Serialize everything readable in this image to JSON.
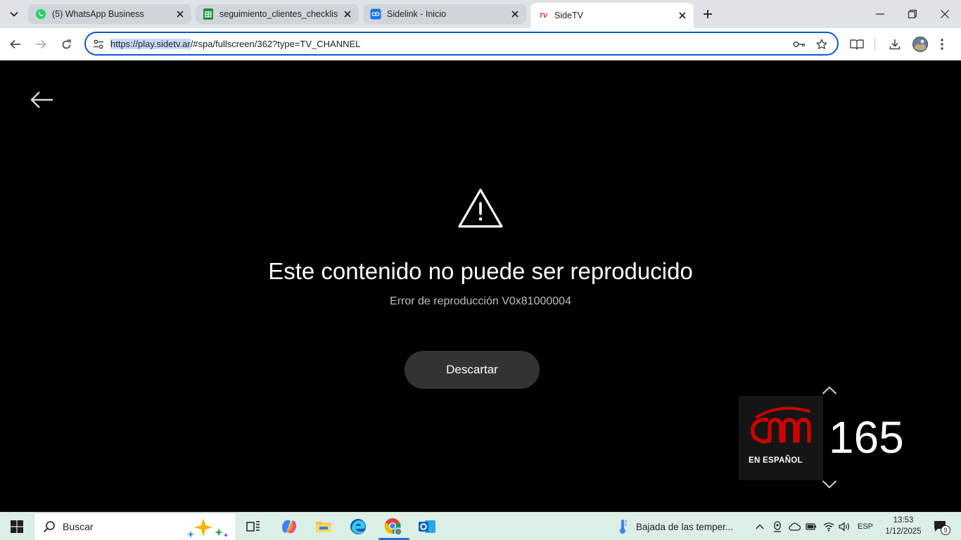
{
  "browser": {
    "tabs": [
      {
        "title": "(5) WhatsApp Business",
        "active": false,
        "favicon": "whatsapp-icon"
      },
      {
        "title": "seguimiento_clientes_checklist",
        "active": false,
        "favicon": "sheets-icon"
      },
      {
        "title": "Sidelink - Inicio",
        "active": false,
        "favicon": "sidelink-icon"
      },
      {
        "title": "SideTV",
        "active": true,
        "favicon": "sidetv-icon"
      }
    ],
    "sidetv_favicon_text": "TV",
    "url_highlight": "https://play.sidetv.ar",
    "url_rest": "/#spa/fullscreen/362?type=TV_CHANNEL",
    "accent": "#0b57d0"
  },
  "player": {
    "error_title": "Este contenido no puede ser reproducido",
    "error_code": "Error de reproducción V0x81000004",
    "dismiss_label": "Descartar",
    "channel_logo_sub": "EN ESPAÑOL",
    "channel_number": "165",
    "logo_color": "#cc0000"
  },
  "taskbar": {
    "search_label": "Buscar",
    "weather": "Bajada de las temper...",
    "language": "ESP",
    "time": "13:53",
    "date": "1/12/2025",
    "notifications": "9"
  }
}
